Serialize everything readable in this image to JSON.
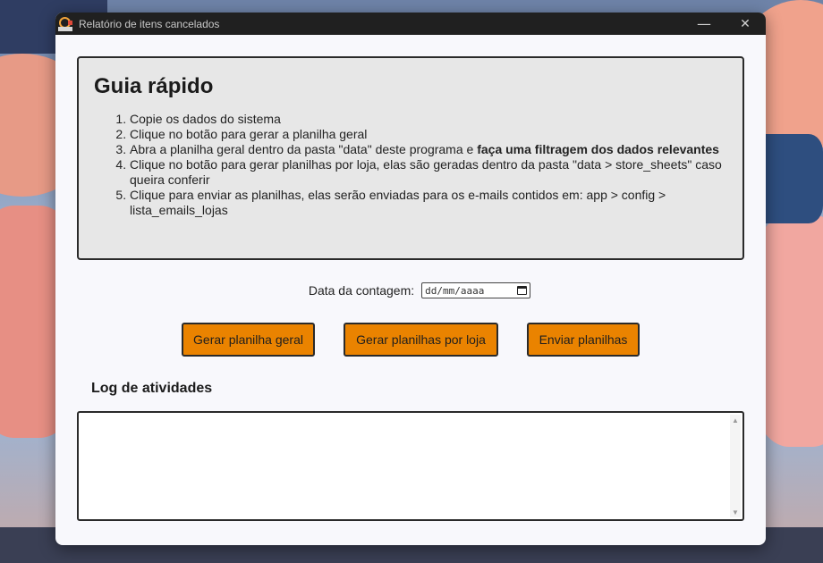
{
  "window": {
    "title": "Relatório de itens cancelados",
    "minimize": "—",
    "close": "✕"
  },
  "guide": {
    "title": "Guia rápido",
    "steps": [
      {
        "text": "Copie os dados do sistema"
      },
      {
        "text": "Clique no botão para gerar a planilha geral"
      },
      {
        "text": "Abra a planilha geral dentro da pasta \"data\" deste programa e ",
        "bold": "faça uma filtragem dos dados relevantes"
      },
      {
        "text": "Clique no botão para gerar planilhas por loja, elas são geradas dentro da pasta \"data > store_sheets\" caso queira conferir"
      },
      {
        "text": "Clique para enviar as planilhas, elas serão enviadas para os e-mails contidos em: app > config > lista_emails_lojas"
      }
    ]
  },
  "date": {
    "label": "Data da contagem:",
    "placeholder": "dd/mm/aaaa"
  },
  "buttons": {
    "general": "Gerar planilha geral",
    "per_store": "Gerar planilhas por loja",
    "send": "Enviar planilhas"
  },
  "log": {
    "title": "Log de atividades",
    "content": ""
  },
  "colors": {
    "accent_button": "#ea8300",
    "titlebar": "#202020",
    "panel": "#e7e7e7"
  }
}
